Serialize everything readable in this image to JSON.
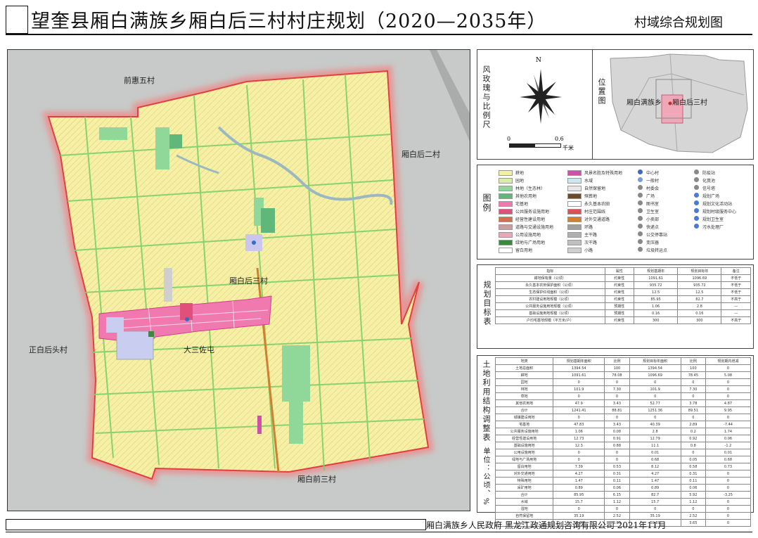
{
  "header": {
    "title": "望奎县厢白满族乡厢白后三村村庄规划（2020—2035年）",
    "map_name": "村域综合规划图"
  },
  "map": {
    "places": {
      "north_village": "前惠五村",
      "east_village": "厢白后二村",
      "west_village": "正白后头村",
      "south_village": "厢白前三村",
      "center_village": "厢白后三村",
      "settlement": "大三佐屯"
    }
  },
  "compass": {
    "label": "风玫瑰与比例尺",
    "north": "N",
    "scale_start": "0",
    "scale_end": "0.6",
    "scale_unit": "千米"
  },
  "location": {
    "label": "位置图",
    "township": "厢白满族乡",
    "village": "厢白后三村"
  },
  "legend": {
    "label": "图例",
    "col1": [
      {
        "text": "耕地",
        "color": "#f5f0a8"
      },
      {
        "text": "园地",
        "color": "#d9ecaa"
      },
      {
        "text": "林地（生态林）",
        "color": "#8fd89a"
      },
      {
        "text": "其他农用地",
        "color": "#5fb87a"
      },
      {
        "text": "宅基地",
        "color": "#f07ab0"
      },
      {
        "text": "公共服务设施用地",
        "color": "#e0507a"
      },
      {
        "text": "经营性建设用地",
        "color": "#d07050"
      },
      {
        "text": "道路与交通设施用地",
        "color": "#c8a0a0"
      },
      {
        "text": "公用设施用地",
        "color": "#e8a8b8"
      },
      {
        "text": "绿地与广场用地",
        "color": "#3a8a3a"
      },
      {
        "text": "留白用地",
        "color": "#ffffff"
      }
    ],
    "col2": [
      {
        "text": "风景名胜及特殊用地",
        "color": "#d050a8"
      },
      {
        "text": "水域",
        "color": "#cfe8f0"
      },
      {
        "text": "自然保留地",
        "color": "#e8e8e8"
      },
      {
        "text": "殡葬地",
        "color": "#6a4a2a"
      },
      {
        "text": "永久基本农田",
        "color": "#ffffff"
      },
      {
        "text": "村庄范围线",
        "color": "#e05050"
      },
      {
        "text": "对外交通道路",
        "color": "#d08030"
      },
      {
        "text": "环路",
        "color": "#a0a0a0"
      },
      {
        "text": "主干路",
        "color": "#b0b0b0"
      },
      {
        "text": "次干路",
        "color": "#c0c0c0"
      },
      {
        "text": "小路",
        "color": "#d0d0d0"
      }
    ],
    "col3": [
      {
        "text": "中心村",
        "color": "#3a6ac8"
      },
      {
        "text": "一般村",
        "color": "#7a9ad8"
      },
      {
        "text": "村委会",
        "color": "#888888"
      },
      {
        "text": "广场",
        "color": "#888888"
      },
      {
        "text": "图书室",
        "color": "#888888"
      },
      {
        "text": "卫生室",
        "color": "#888888"
      },
      {
        "text": "小卖部",
        "color": "#888888"
      },
      {
        "text": "快递点",
        "color": "#888888"
      },
      {
        "text": "公交停靠站",
        "color": "#888888"
      },
      {
        "text": "变压器",
        "color": "#888888"
      },
      {
        "text": "垃圾转运点",
        "color": "#888888"
      }
    ],
    "col4": [
      {
        "text": "防疫站",
        "color": "#888888"
      },
      {
        "text": "化粪池",
        "color": "#888888"
      },
      {
        "text": "信号塔",
        "color": "#888888"
      },
      {
        "text": "规划广场",
        "color": "#4a7ad8"
      },
      {
        "text": "规划文化活动站",
        "color": "#4a7ad8"
      },
      {
        "text": "规划村级服务中心",
        "color": "#4a7ad8"
      },
      {
        "text": "规划卫生室",
        "color": "#4a7ad8"
      },
      {
        "text": "污水处理厂",
        "color": "#4a7ad8"
      }
    ]
  },
  "targets": {
    "label": "规划目标表",
    "headers": [
      "指标",
      "属性",
      "规划基期年",
      "规划目标年",
      "备注"
    ],
    "rows": [
      [
        "耕地保有量（公顷）",
        "约束性",
        "1091.61",
        "1096.69",
        "不低于"
      ],
      [
        "永久基本农田保护面积（公顷）",
        "约束性",
        "935.72",
        "935.72",
        "不低于"
      ],
      [
        "生态保护红线面积（公顷）",
        "约束性",
        "12.5",
        "12.5",
        "不低于"
      ],
      [
        "农村建设用地规模（公顷）",
        "约束性",
        "85.95",
        "82.7",
        "不高于"
      ],
      [
        "公共服务设施用地规模（公顷）",
        "预期性",
        "1.06",
        "2.8",
        "—"
      ],
      [
        "基础设施用地规模（公顷）",
        "预期性",
        "0.16",
        "0.16",
        "—"
      ],
      [
        "户均宅基地规模（平方米/户）",
        "约束性",
        "300",
        "300",
        "不高于"
      ]
    ]
  },
  "landuse": {
    "label": "土地利用结构调整表",
    "unit": "单位：公顷、%",
    "headers": [
      "地类",
      "规划基期年面积",
      "比例",
      "规划目标年面积",
      "比例",
      "规划期内增减"
    ],
    "rows": [
      [
        "土地总面积",
        "1394.54",
        "100",
        "1394.54",
        "100",
        "0"
      ],
      [
        "耕地",
        "1091.61",
        "78.08",
        "1096.69",
        "78.45",
        "5.08"
      ],
      [
        "园地",
        "0",
        "0",
        "0",
        "0",
        "0"
      ],
      [
        "林地",
        "101.9",
        "7.30",
        "101.9",
        "7.30",
        "0"
      ],
      [
        "草地",
        "0",
        "0",
        "0",
        "0",
        "0"
      ],
      [
        "其他农用地",
        "47.9",
        "3.43",
        "52.77",
        "3.78",
        "4.87"
      ],
      [
        "合计",
        "1241.41",
        "88.81",
        "1251.36",
        "89.51",
        "9.95"
      ],
      [
        "城镇建设用地",
        "0",
        "0",
        "0",
        "0",
        "0"
      ],
      [
        "宅基地",
        "47.83",
        "3.43",
        "40.39",
        "2.89",
        "-7.44"
      ],
      [
        "公共服务设施用地",
        "1.06",
        "0.08",
        "2.8",
        "0.2",
        "1.74"
      ],
      [
        "经营性建设用地",
        "12.73",
        "0.91",
        "12.79",
        "0.92",
        "0.06"
      ],
      [
        "基础设施用地",
        "12.3",
        "0.88",
        "11.1",
        "0.8",
        "-1.2"
      ],
      [
        "公用设施用地",
        "0",
        "0",
        "0.01",
        "0",
        "0.01"
      ],
      [
        "绿地与广场用地",
        "0",
        "0",
        "0.68",
        "0.05",
        "0.68"
      ],
      [
        "留白用地",
        "7.39",
        "0.53",
        "8.12",
        "0.58",
        "0.73"
      ],
      [
        "对外交通用地",
        "4.27",
        "0.31",
        "4.27",
        "0.31",
        "0"
      ],
      [
        "特殊用地",
        "1.47",
        "0.11",
        "1.47",
        "0.11",
        "0"
      ],
      [
        "采矿用地",
        "0.89",
        "0.06",
        "0.89",
        "0.06",
        "0"
      ],
      [
        "合计",
        "85.95",
        "6.15",
        "82.7",
        "5.92",
        "-3.25"
      ],
      [
        "水域",
        "15.7",
        "1.12",
        "15.7",
        "1.12",
        "0"
      ],
      [
        "湿地",
        "0",
        "0",
        "0",
        "0",
        "0"
      ],
      [
        "自然保留地",
        "35.19",
        "2.52",
        "35.19",
        "2.52",
        "0"
      ],
      [
        "合计",
        "50.89",
        "3.65",
        "50.89",
        "3.65",
        "0"
      ]
    ]
  },
  "footer": {
    "text": "厢白满族乡人民政府  黑龙江政通规划咨询有限公司  2021年11月"
  }
}
